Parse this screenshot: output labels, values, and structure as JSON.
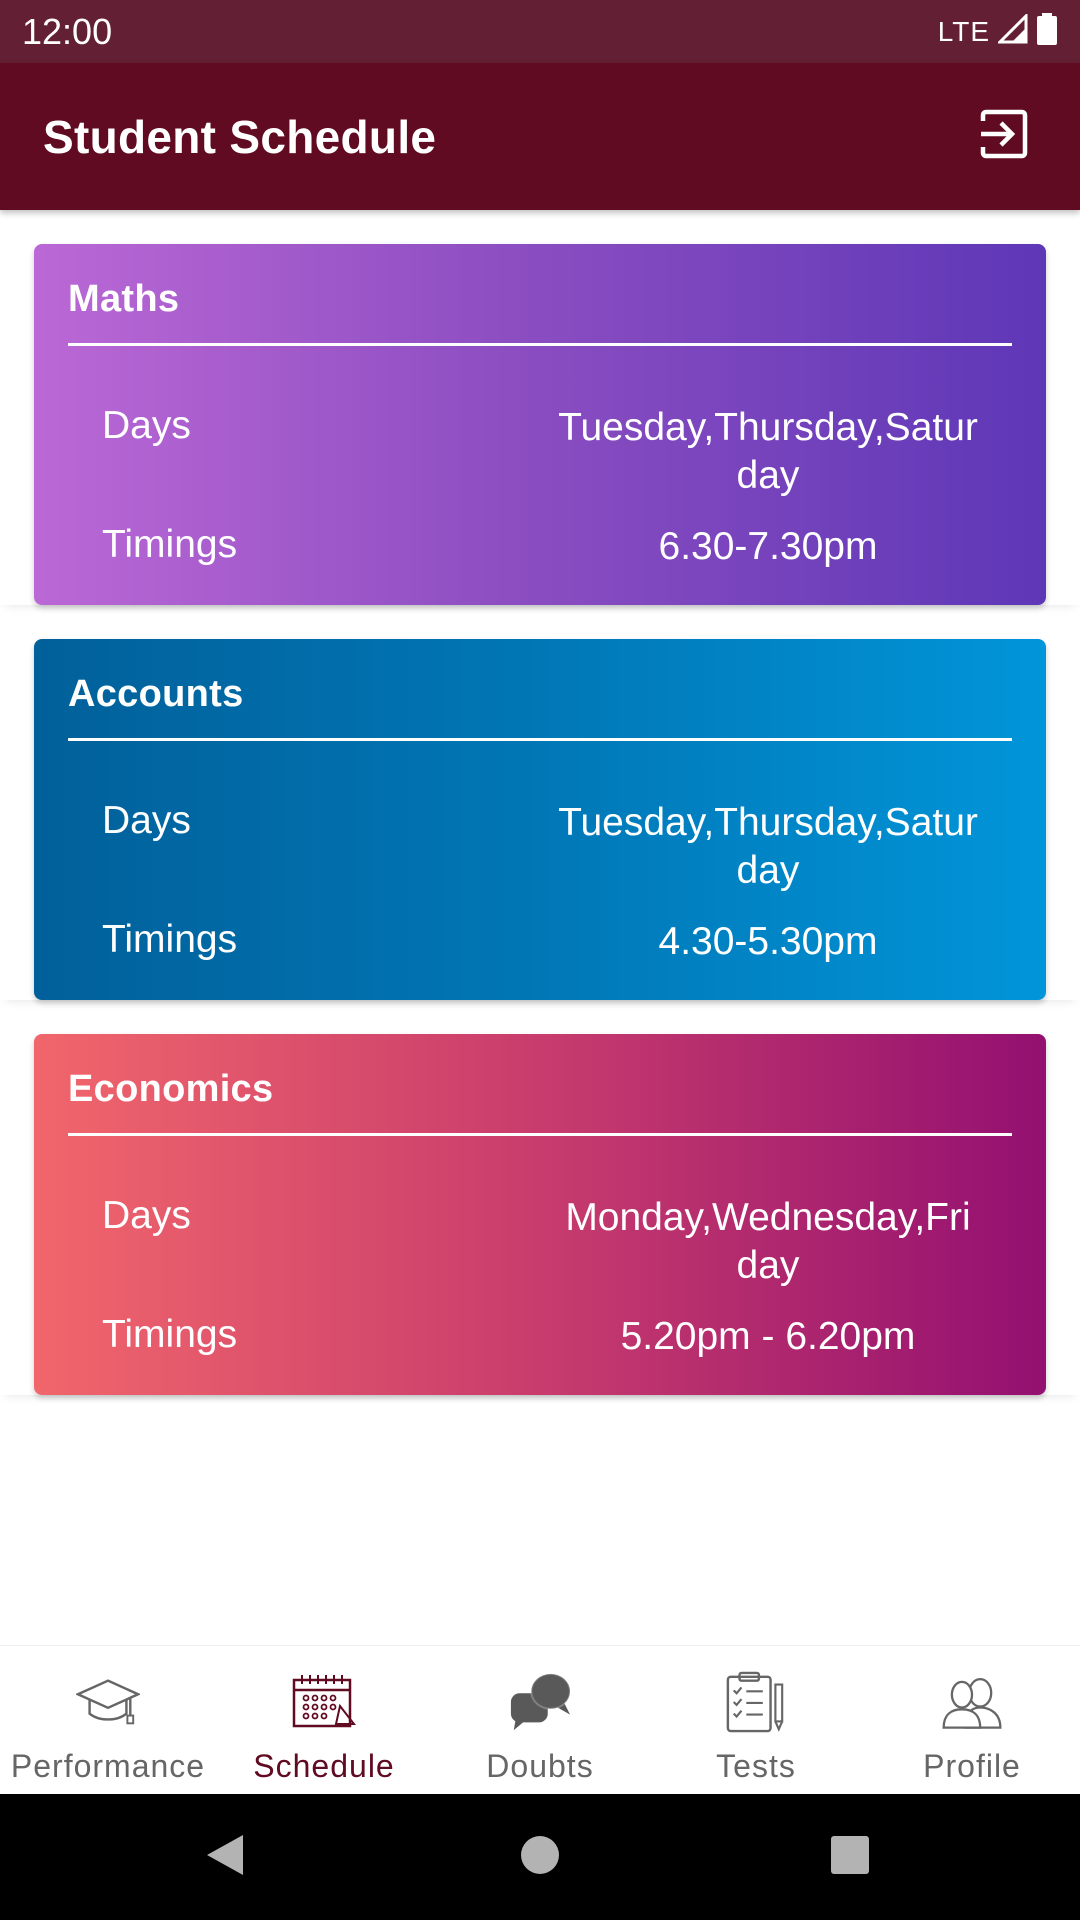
{
  "status_bar": {
    "time": "12:00",
    "network": "LTE"
  },
  "app_bar": {
    "title": "Student Schedule",
    "action_icon": "logout-icon"
  },
  "colors": {
    "status_bar": "#631f33",
    "app_bar": "#600b21",
    "active_nav": "#600b21",
    "inactive_nav": "#666666"
  },
  "schedule": {
    "cards": [
      {
        "subject": "Maths",
        "days_label": "Days",
        "days": "Tuesday,Thursday,Saturday",
        "timings_label": "Timings",
        "timings": "6.30-7.30pm"
      },
      {
        "subject": "Accounts",
        "days_label": "Days",
        "days": "Tuesday,Thursday,Saturday",
        "timings_label": "Timings",
        "timings": "4.30-5.30pm"
      },
      {
        "subject": "Economics",
        "days_label": "Days",
        "days": "Monday,Wednesday,Friday",
        "timings_label": "Timings",
        "timings": "5.20pm - 6.20pm"
      }
    ]
  },
  "bottom_nav": {
    "items": [
      {
        "label": "Performance",
        "icon": "graduation-cap-icon",
        "active": false
      },
      {
        "label": "Schedule",
        "icon": "calendar-icon",
        "active": true
      },
      {
        "label": "Doubts",
        "icon": "chat-bubbles-icon",
        "active": false
      },
      {
        "label": "Tests",
        "icon": "clipboard-checklist-icon",
        "active": false
      },
      {
        "label": "Profile",
        "icon": "users-icon",
        "active": false
      }
    ]
  }
}
